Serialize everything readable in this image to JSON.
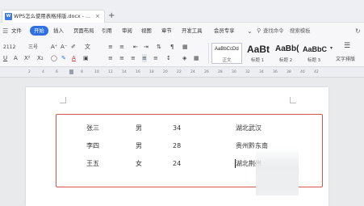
{
  "tab": {
    "title": "WPS怎么使用表格排版.docx - ...",
    "close_glyph": "×",
    "add_glyph": "+"
  },
  "menu": {
    "items": [
      "文件",
      "开始",
      "插入",
      "页面布局",
      "引用",
      "审阅",
      "视图",
      "章节",
      "开发工具",
      "会员专享"
    ],
    "active": "开始",
    "search_label": "查找命令",
    "search_template_label": "搜索模板"
  },
  "ribbon": {
    "font_name": "2112",
    "font_size": "三号",
    "bold": "B",
    "italic": "I",
    "underline": "U",
    "strikethrough": "A",
    "superscript": "X²",
    "subscript": "X₂",
    "font_color": "A",
    "styles": [
      {
        "sample": "AaBbCcDd",
        "name": "正文"
      },
      {
        "sample": "AaBt",
        "name": "标题 1"
      },
      {
        "sample": "AaBb(",
        "name": "标题 2"
      },
      {
        "sample": "AaBbC",
        "name": "标题 3"
      }
    ],
    "text_tools_label": "文字排版"
  },
  "ruler": {
    "ticks": [
      "2",
      "4",
      "6",
      "8",
      "10",
      "12",
      "14",
      "16",
      "18",
      "20",
      "22",
      "24",
      "26",
      "28",
      "30",
      "32",
      "34",
      "36",
      "38",
      "40",
      "42"
    ]
  },
  "document": {
    "rows": [
      [
        "张三",
        "男",
        "34",
        "湖北武汉"
      ],
      [
        "李四",
        "男",
        "28",
        "贵州黔东南"
      ],
      [
        "王五",
        "女",
        "24",
        "湖北荆州"
      ]
    ]
  },
  "colors": {
    "accent": "#2f6fe6",
    "highlight_border": "#d9534f"
  }
}
